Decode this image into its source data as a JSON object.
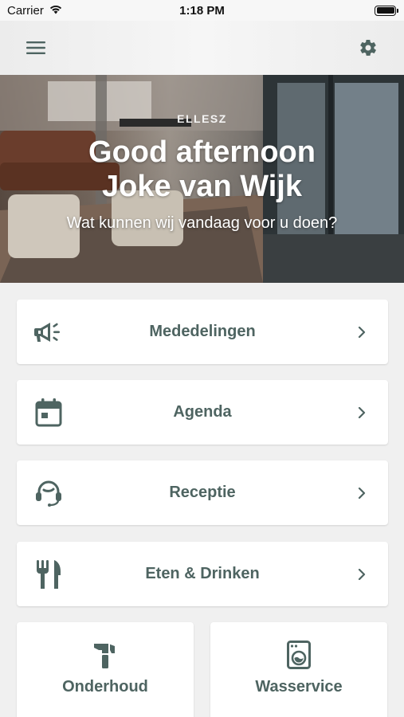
{
  "status_bar": {
    "carrier": "Carrier",
    "time": "1:18 PM",
    "signal_icon": "wifi-icon",
    "battery_icon": "battery-icon"
  },
  "nav": {
    "menu_icon": "hamburger-icon",
    "settings_icon": "gear-icon"
  },
  "hero": {
    "brand": "ELLESZ",
    "greeting": "Good afternoon",
    "user_name": "Joke van Wijk",
    "subtitle": "Wat kunnen wij vandaag voor u doen?"
  },
  "menu": [
    {
      "label": "Mededelingen",
      "icon": "megaphone-icon"
    },
    {
      "label": "Agenda",
      "icon": "calendar-icon"
    },
    {
      "label": "Receptie",
      "icon": "headset-icon"
    },
    {
      "label": "Eten & Drinken",
      "icon": "fork-knife-icon"
    }
  ],
  "tiles": [
    {
      "label": "Onderhoud",
      "icon": "hammer-icon"
    },
    {
      "label": "Wasservice",
      "icon": "washing-machine-icon"
    }
  ],
  "colors": {
    "accent": "#4e6461",
    "background": "#f0f0f0",
    "card": "#ffffff"
  }
}
